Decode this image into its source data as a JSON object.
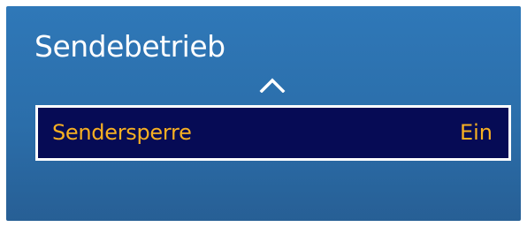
{
  "menu": {
    "title": "Sendebetrieb",
    "scroll_up_icon": "chevron-up-icon",
    "items": [
      {
        "label": "Sendersperre",
        "value": "Ein",
        "selected": true
      }
    ]
  },
  "colors": {
    "panel_background": "#2b6eaa",
    "selected_item_background": "#060b55",
    "selected_item_border": "#ffffff",
    "highlight_text": "#f7b022",
    "title_text": "#ffffff"
  }
}
